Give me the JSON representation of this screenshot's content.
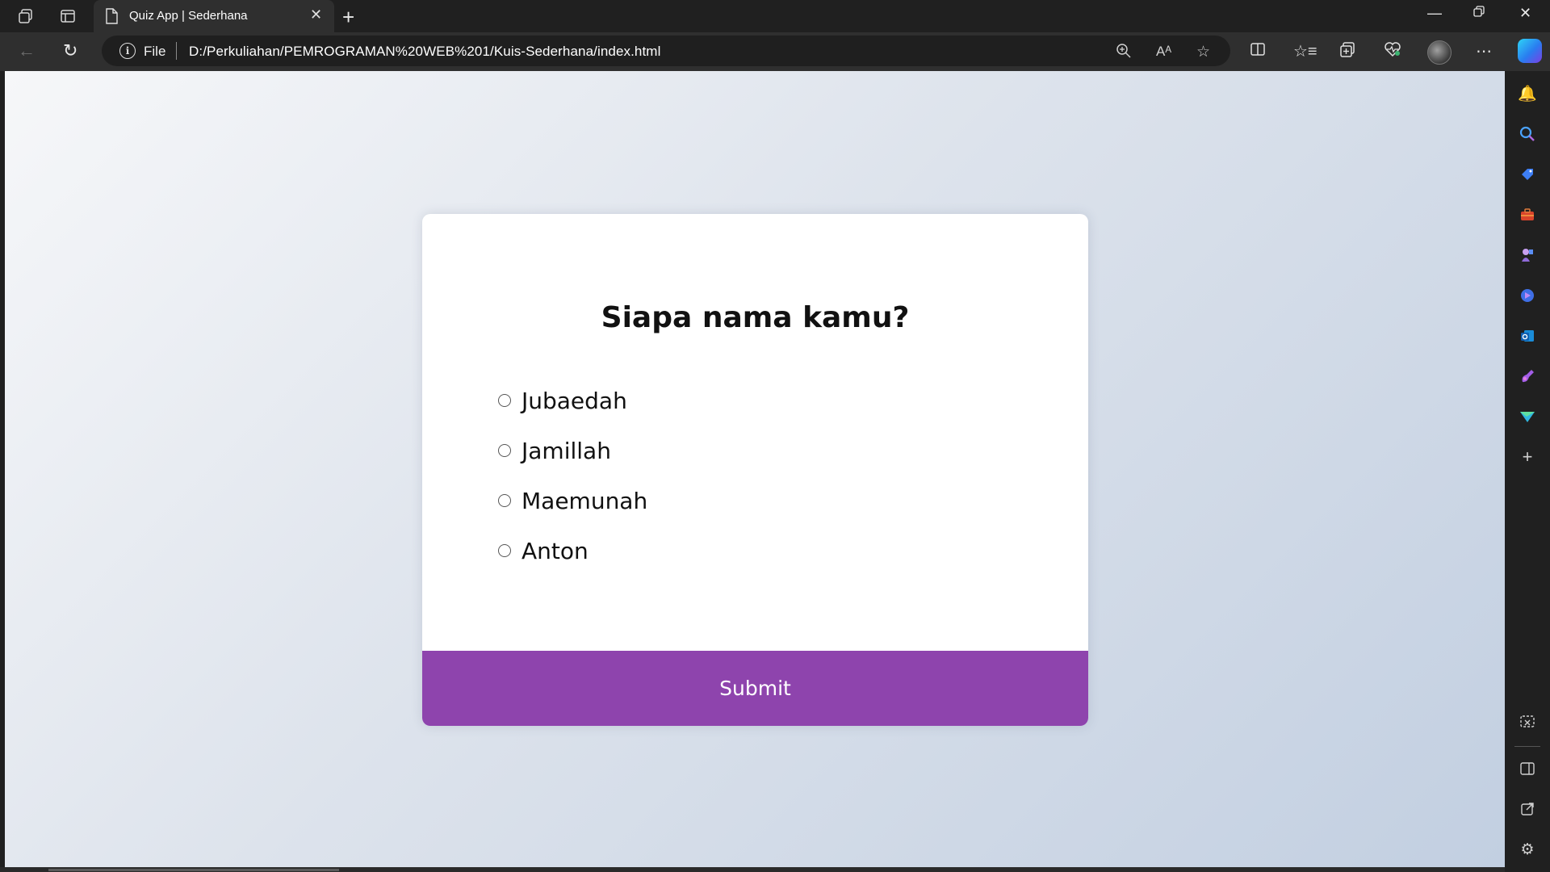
{
  "browser": {
    "tab": {
      "title": "Quiz App | Sederhana"
    },
    "address": {
      "scheme_label": "File",
      "url": "D:/Perkuliahan/PEMROGRAMAN%20WEB%201/Kuis-Sederhana/index.html"
    }
  },
  "quiz": {
    "question": "Siapa nama kamu?",
    "answers": [
      {
        "label": "Jubaedah"
      },
      {
        "label": "Jamillah"
      },
      {
        "label": "Maemunah"
      },
      {
        "label": "Anton"
      }
    ],
    "submit_label": "Submit"
  },
  "colors": {
    "accent": "#8e44ad",
    "chrome_dark": "#202020",
    "chrome_toolbar": "#2f2f2f"
  },
  "icons": {
    "titlebar": [
      "workspaces-icon",
      "tab-actions-icon",
      "page-icon",
      "close-icon",
      "new-tab-icon",
      "minimize-icon",
      "restore-icon",
      "window-close-icon"
    ],
    "toolbar": [
      "back-icon",
      "refresh-icon",
      "info-icon",
      "zoom-icon",
      "read-aloud-icon",
      "favorite-star-icon",
      "split-screen-icon",
      "favorites-icon",
      "collections-icon",
      "browser-essentials-icon",
      "profile-avatar",
      "more-icon",
      "copilot-icon"
    ],
    "sidebar": [
      "notification-bell-icon",
      "search-icon",
      "shopping-tag-icon",
      "tools-briefcase-icon",
      "games-icon",
      "bing-icon",
      "outlook-icon",
      "designer-icon",
      "send-icon",
      "add-icon",
      "screenshot-icon",
      "sidebar-panel-icon",
      "external-open-icon",
      "settings-icon"
    ]
  }
}
